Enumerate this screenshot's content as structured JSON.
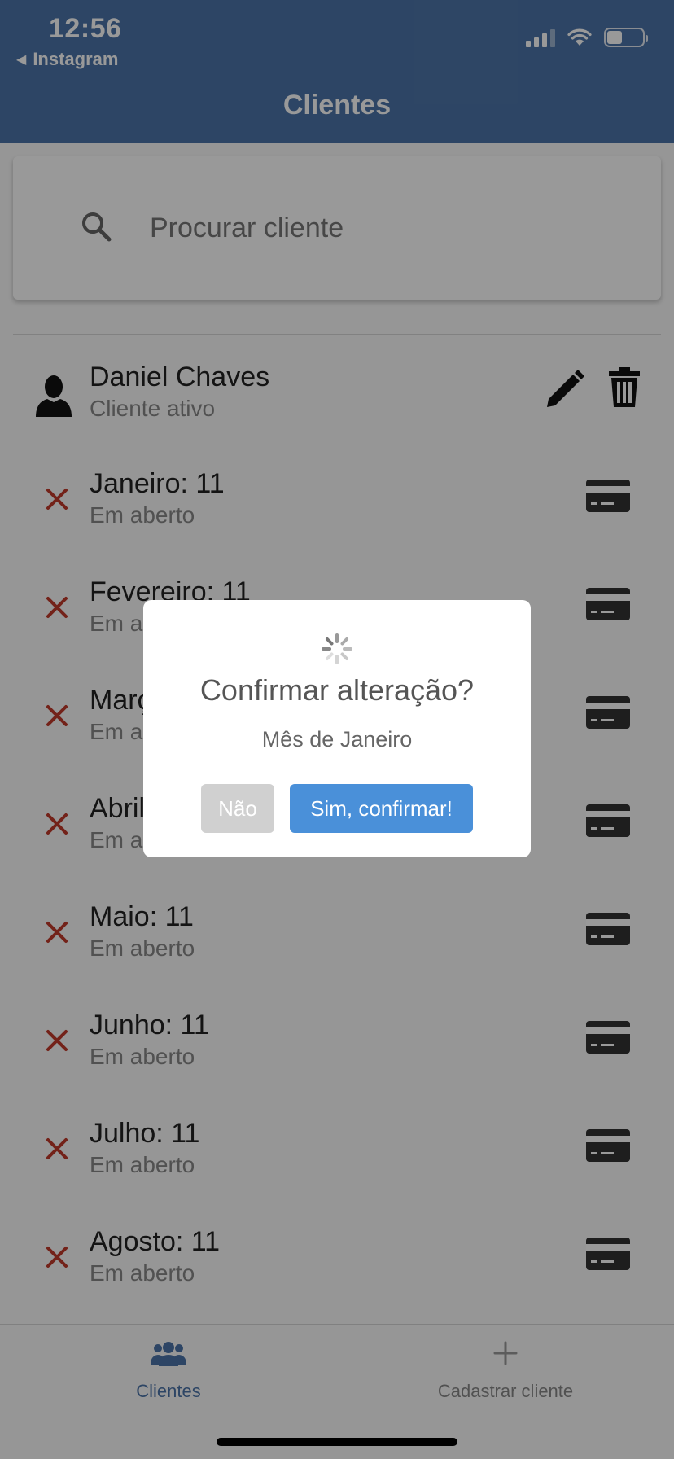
{
  "status_bar": {
    "time": "12:56",
    "back_app_label": "Instagram"
  },
  "header": {
    "title": "Clientes"
  },
  "search": {
    "placeholder": "Procurar cliente"
  },
  "client": {
    "name": "Daniel Chaves",
    "status": "Cliente ativo"
  },
  "months": [
    {
      "title": "Janeiro: 11",
      "status": "Em aberto"
    },
    {
      "title": "Fevereiro: 11",
      "status": "Em aberto"
    },
    {
      "title": "Março: 11",
      "status": "Em aberto"
    },
    {
      "title": "Abril: 11",
      "status": "Em aberto"
    },
    {
      "title": "Maio: 11",
      "status": "Em aberto"
    },
    {
      "title": "Junho: 11",
      "status": "Em aberto"
    },
    {
      "title": "Julho: 11",
      "status": "Em aberto"
    },
    {
      "title": "Agosto: 11",
      "status": "Em aberto"
    }
  ],
  "bottom_nav": {
    "clientes_label": "Clientes",
    "cadastrar_label": "Cadastrar cliente"
  },
  "modal": {
    "title": "Confirmar alteração?",
    "text": "Mês de Janeiro",
    "cancel_label": "Não",
    "confirm_label": "Sim, confirmar!"
  },
  "colors": {
    "header": "#4c74a8",
    "accent": "#4a90d9",
    "x_icon": "#c0392b"
  }
}
